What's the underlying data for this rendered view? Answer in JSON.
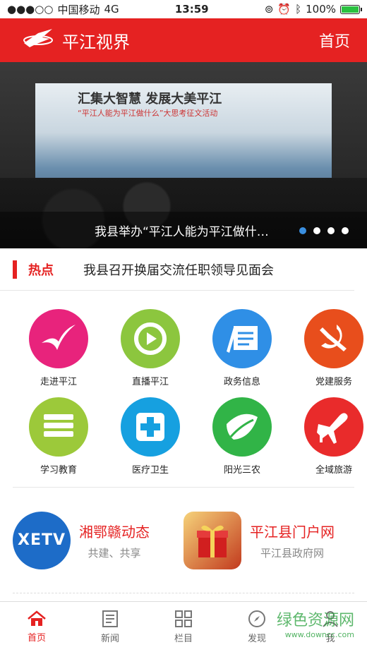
{
  "status": {
    "carrier": "中国移动",
    "network": "4G",
    "time": "13:59",
    "battery": "100%",
    "battery_level": 1.0
  },
  "header": {
    "title": "平江视界",
    "home_label": "首页"
  },
  "banner": {
    "screen_title": "汇集大智慧 发展大美平江",
    "screen_sub": "“平江人能为平江做什么”大思考征文活动",
    "caption": "我县举办“平江人能为平江做什…",
    "active_dot": 0,
    "dot_count": 4
  },
  "hot": {
    "tag": "热点",
    "title": "我县召开换届交流任职领导见面会"
  },
  "grid": {
    "items": [
      {
        "label": "走进平江",
        "icon": "bird-icon",
        "color": "#e8237c"
      },
      {
        "label": "直播平江",
        "icon": "play-icon",
        "color": "#8cc63e"
      },
      {
        "label": "政务信息",
        "icon": "document-pen-icon",
        "color": "#2f8fe6"
      },
      {
        "label": "党建服务",
        "icon": "hammer-sickle-icon",
        "color": "#e84e1c"
      },
      {
        "label": "学习教育",
        "icon": "books-icon",
        "color": "#9cc93a"
      },
      {
        "label": "医疗卫生",
        "icon": "medical-cross-icon",
        "color": "#16a0e0"
      },
      {
        "label": "阳光三农",
        "icon": "leaf-icon",
        "color": "#31b447"
      },
      {
        "label": "全域旅游",
        "icon": "airplane-icon",
        "color": "#e92b2b"
      }
    ]
  },
  "cards": [
    {
      "title": "湘鄂赣动态",
      "subtitle": "共建、共享",
      "logo_text": "XETV"
    },
    {
      "title": "平江县门户网",
      "subtitle": "平江县政府网"
    }
  ],
  "tabbar": {
    "items": [
      {
        "label": "首页",
        "icon": "home-icon",
        "active": true
      },
      {
        "label": "新闻",
        "icon": "news-icon",
        "active": false
      },
      {
        "label": "栏目",
        "icon": "grid-icon",
        "active": false
      },
      {
        "label": "发现",
        "icon": "compass-icon",
        "active": false
      },
      {
        "label": "我",
        "icon": "user-icon",
        "active": false
      }
    ]
  },
  "watermark": {
    "text": "绿色资源网",
    "url": "www.downcc.com"
  }
}
